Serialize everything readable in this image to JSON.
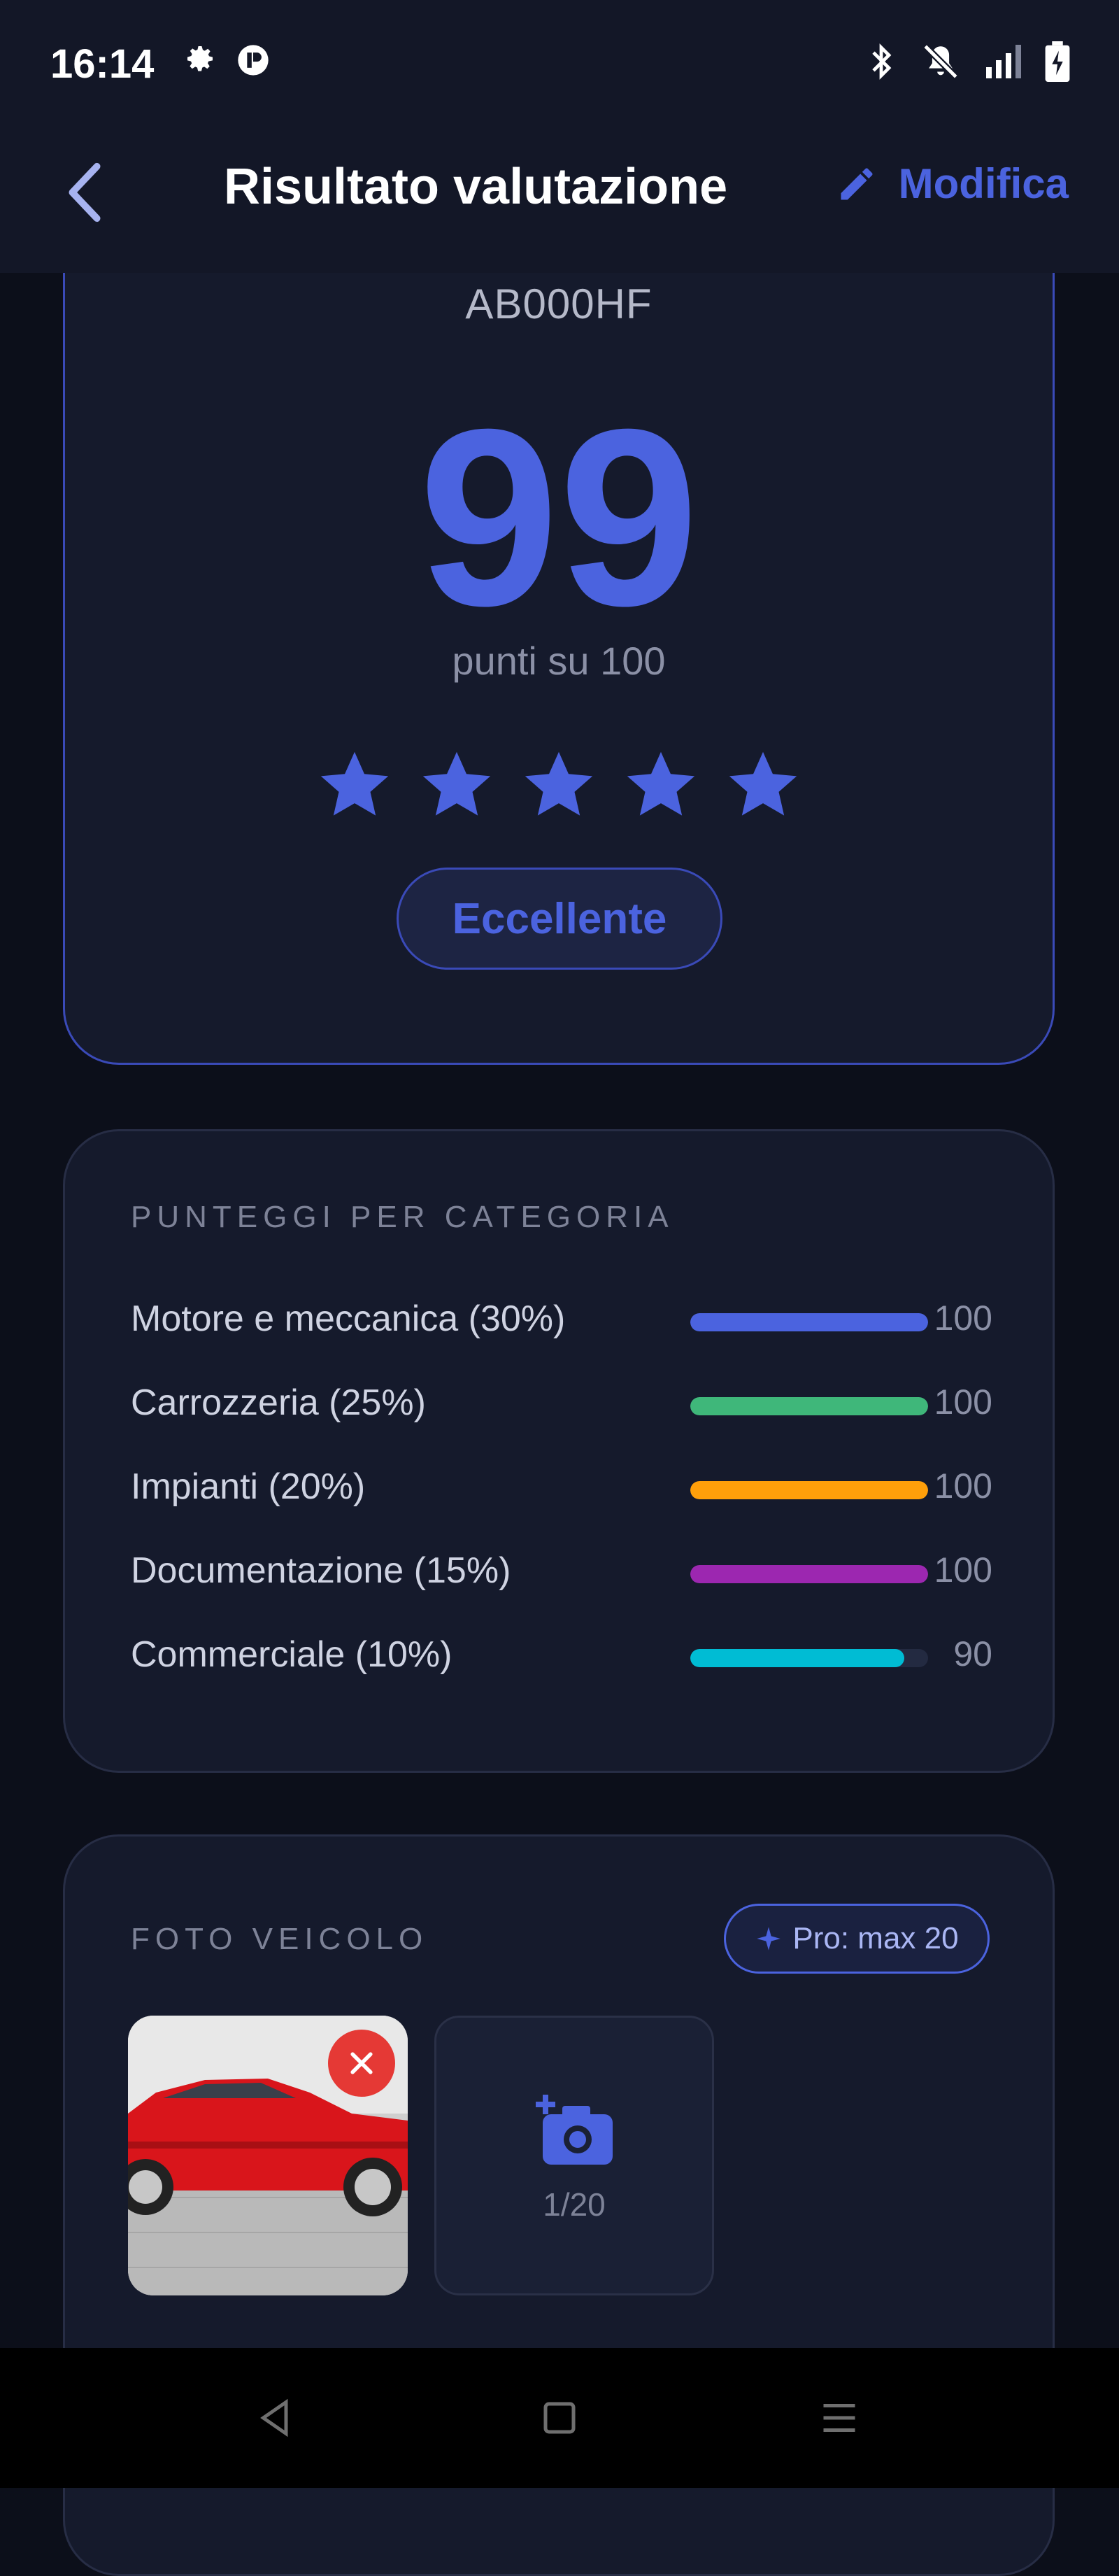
{
  "status_bar": {
    "time": "16:14"
  },
  "app_bar": {
    "title": "Risultato valutazione",
    "edit_label": "Modifica"
  },
  "score_card": {
    "plate": "AB000HF",
    "score": "99",
    "score_caption": "punti su 100",
    "stars_filled": 5,
    "stars_total": 5,
    "rating_label": "Eccellente"
  },
  "categories": {
    "title": "PUNTEGGI PER CATEGORIA",
    "items": [
      {
        "label": "Motore e meccanica (30%)",
        "value": "100",
        "fraction": 1.0,
        "color": "#4b63df"
      },
      {
        "label": "Carrozzeria (25%)",
        "value": "100",
        "fraction": 1.0,
        "color": "#3fb77a"
      },
      {
        "label": "Impianti (20%)",
        "value": "100",
        "fraction": 1.0,
        "color": "#ff9f0a"
      },
      {
        "label": "Documentazione (15%)",
        "value": "100",
        "fraction": 1.0,
        "color": "#9c27b0"
      },
      {
        "label": "Commerciale (10%)",
        "value": "90",
        "fraction": 0.9,
        "color": "#00bcd4"
      }
    ]
  },
  "photos": {
    "title": "FOTO VEICOLO",
    "pro_badge": "Pro: max 20",
    "count": "1/20"
  },
  "colors": {
    "accent": "#4b63df",
    "danger": "#e53935"
  }
}
